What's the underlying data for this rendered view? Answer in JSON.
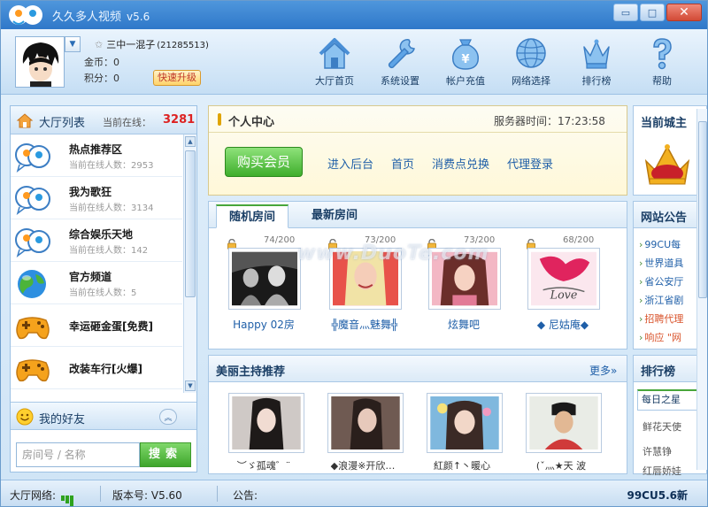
{
  "app": {
    "title": "久久多人视频",
    "version": "v5.6",
    "window_buttons": {
      "minimize": "▭",
      "maximize": "□",
      "close": "✕"
    }
  },
  "user": {
    "nickname": "三中一混子",
    "uid": "(21285513)",
    "gold_label": "金币：0",
    "points_label": "积分：0",
    "upgrade_label": "快速升级"
  },
  "nav": [
    {
      "label": "大厅首页",
      "icon": "home-icon"
    },
    {
      "label": "系统设置",
      "icon": "wrench-icon"
    },
    {
      "label": "帐户充值",
      "icon": "money-bag-icon"
    },
    {
      "label": "网络选择",
      "icon": "globe-icon"
    },
    {
      "label": "排行榜",
      "icon": "crown-icon"
    },
    {
      "label": "帮助",
      "icon": "question-icon"
    }
  ],
  "hall": {
    "title": "大厅列表",
    "online_label": "当前在线：",
    "online_count": "3281",
    "items": [
      {
        "name": "热点推荐区",
        "online": "当前在线人数：2953",
        "icon": "chat-bubbles-icon"
      },
      {
        "name": "我为歌狂",
        "online": "当前在线人数：3134",
        "icon": "chat-bubbles-icon"
      },
      {
        "name": "综合娱乐天地",
        "online": "当前在线人数：142",
        "icon": "chat-bubbles-icon"
      },
      {
        "name": "官方频道",
        "online": "当前在线人数：5",
        "icon": "earth-icon"
      },
      {
        "name": "幸运砸金蛋[免费]",
        "online": "",
        "icon": "gamepad-icon"
      },
      {
        "name": "改装车行[火爆]",
        "online": "",
        "icon": "gamepad-icon"
      }
    ]
  },
  "friends": {
    "title": "我的好友",
    "search_placeholder": "房间号 / 名称",
    "search_button": "搜索"
  },
  "personal": {
    "title": "个人中心",
    "server_time_label": "服务器时间：",
    "server_time": "17:23:58",
    "buy_button": "购买会员",
    "links": [
      "进入后台",
      "首页",
      "消费点兑换",
      "代理登录"
    ]
  },
  "rooms": {
    "tabs": [
      "随机房间",
      "最新房间"
    ],
    "items": [
      {
        "count": "74/200",
        "name": "Happy 02房",
        "img": "bw"
      },
      {
        "count": "73/200",
        "name": "╬魔音灬魅舞╬",
        "img": "blonde"
      },
      {
        "count": "73/200",
        "name": "炫舞吧",
        "img": "pink"
      },
      {
        "count": "68/200",
        "name": "◆ 尼姑庵◆",
        "img": "love"
      }
    ]
  },
  "hosts": {
    "title": "美丽主持推荐",
    "more_label": "更多»",
    "items": [
      {
        "name": "︶ゞ孤魂゛¨",
        "img": "h1"
      },
      {
        "name": "◆浪漫※开欣…",
        "img": "h2"
      },
      {
        "name": "紅颜↑丶暖心",
        "img": "h3"
      },
      {
        "name": "(ˇ灬★天 波",
        "img": "h4"
      }
    ]
  },
  "right": {
    "top_title": "当前城主",
    "notice_title": "网站公告",
    "notices": [
      {
        "text": "99CU每",
        "color": "#1f5fa8"
      },
      {
        "text": "世界道具",
        "color": "#1f5fa8"
      },
      {
        "text": "省公安厅",
        "color": "#1f5fa8"
      },
      {
        "text": "浙江省剧",
        "color": "#1f5fa8"
      },
      {
        "text": "招聘代理",
        "color": "#d9532b"
      },
      {
        "text": "响应 \"网",
        "color": "#d9532b"
      }
    ],
    "rank_title": "排行榜",
    "rank_tab": "每日之星",
    "rank_items": [
      "鲜花天使",
      "许慧铮",
      "红唇娇娃"
    ]
  },
  "status": {
    "network_label": "大厅网络:",
    "version_label": "版本号:  V5.60",
    "notice_label": "公告:",
    "version_right": "99CU5.6新"
  },
  "watermark": "www.DuoTe.com"
}
